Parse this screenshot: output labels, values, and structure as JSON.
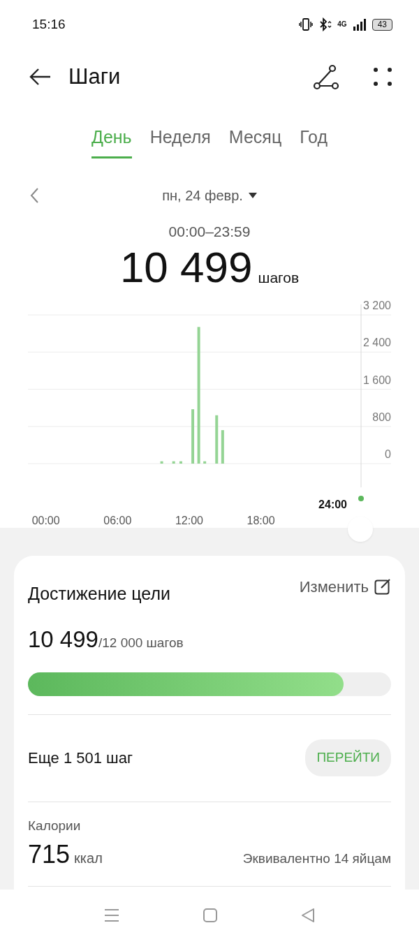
{
  "status_bar": {
    "time": "15:16",
    "network": "4G",
    "battery": "43"
  },
  "header": {
    "title": "Шаги"
  },
  "tabs": [
    {
      "label": "День",
      "selected": true
    },
    {
      "label": "Неделя",
      "selected": false
    },
    {
      "label": "Месяц",
      "selected": false
    },
    {
      "label": "Год",
      "selected": false
    }
  ],
  "date": {
    "label": "пн, 24 февр.",
    "range": "00:00–23:59"
  },
  "total": {
    "value": "10 499",
    "unit": "шагов"
  },
  "chart": {
    "cursor_label": "24:00",
    "chart_data": {
      "type": "bar",
      "grid": true,
      "x": [
        9.7,
        10.7,
        11.3,
        12.3,
        12.8,
        13.3,
        14.3,
        14.8
      ],
      "values": [
        50,
        50,
        50,
        1170,
        2940,
        50,
        1040,
        720
      ],
      "xlim": [
        -1.5,
        28.9
      ],
      "ylim": [
        0,
        3200
      ],
      "xticks": [
        {
          "value": 0,
          "label": "00:00"
        },
        {
          "value": 6,
          "label": "06:00"
        },
        {
          "value": 12,
          "label": "12:00"
        },
        {
          "value": 18,
          "label": "18:00"
        }
      ],
      "yticks": [
        {
          "value": 0,
          "label": "0"
        },
        {
          "value": 800,
          "label": "800"
        },
        {
          "value": 1600,
          "label": "1 600"
        },
        {
          "value": 2400,
          "label": "2 400"
        },
        {
          "value": 3200,
          "label": "3 200"
        }
      ]
    }
  },
  "goal": {
    "title": "Достижение цели",
    "edit": "Изменить",
    "value": "10 499",
    "target": "/12 000 шагов",
    "level": 0.87,
    "remaining": "Еще 1 501 шаг",
    "go_button": "ПЕРЕЙТИ"
  },
  "calories": {
    "label": "Калории",
    "value": "715",
    "unit": "ккал",
    "equivalent": "Эквивалентно 14 яйцам"
  }
}
